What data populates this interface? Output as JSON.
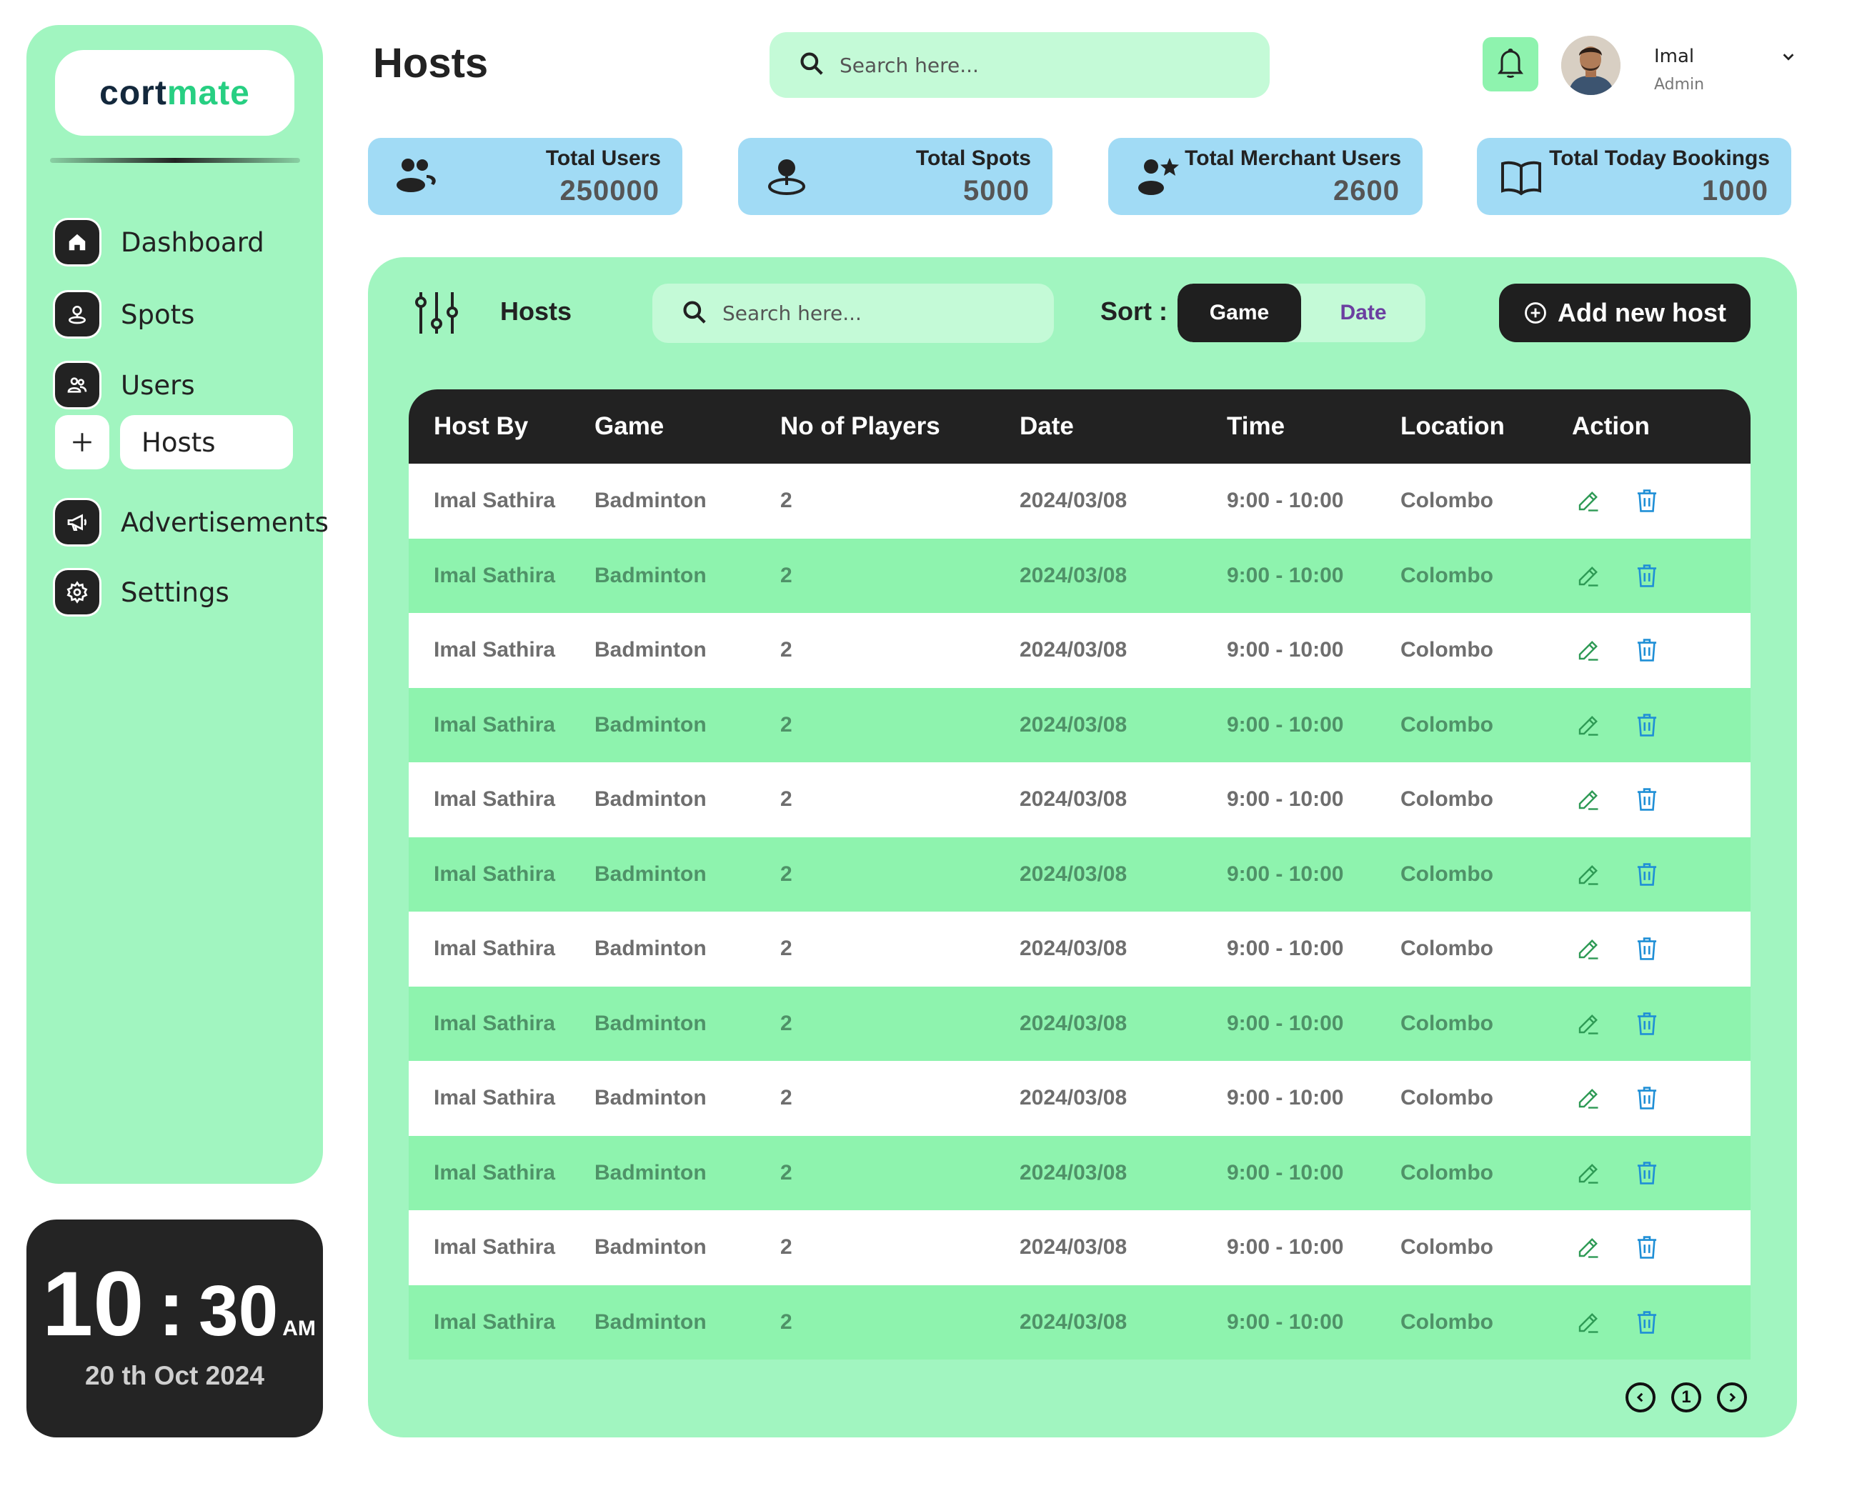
{
  "brand": {
    "logo_part1": "cort",
    "logo_part2": "mate"
  },
  "sidebar": {
    "items": [
      {
        "label": "Dashboard",
        "icon": "home-icon"
      },
      {
        "label": "Spots",
        "icon": "location-pin-icon"
      },
      {
        "label": "Users",
        "icon": "users-icon"
      },
      {
        "label": "Hosts",
        "icon": "plus-icon",
        "active": true
      },
      {
        "label": "Advertisements",
        "icon": "megaphone-icon"
      },
      {
        "label": "Settings",
        "icon": "gear-icon"
      }
    ]
  },
  "clock": {
    "hour": "10",
    "separator": ":",
    "minute": "30",
    "ampm": "AM",
    "date": "20 th Oct 2024"
  },
  "header": {
    "title": "Hosts",
    "search_placeholder": "Search here...",
    "user": {
      "name": "Imal",
      "role": "Admin"
    }
  },
  "stats": [
    {
      "label": "Total Users",
      "value": "250000",
      "icon": "users-icon"
    },
    {
      "label": "Total Spots",
      "value": "5000",
      "icon": "location-pin-icon"
    },
    {
      "label": "Total Merchant Users",
      "value": "2600",
      "icon": "merchant-star-icon"
    },
    {
      "label": "Total Today Bookings",
      "value": "1000",
      "icon": "open-book-icon"
    }
  ],
  "panel": {
    "title": "Hosts",
    "search_placeholder": "Search here...",
    "sort_label": "Sort :",
    "sort_options": [
      "Game",
      "Date"
    ],
    "sort_selected": "Game",
    "add_button": "Add new host"
  },
  "table": {
    "columns": [
      "Host By",
      "Game",
      "No of Players",
      "Date",
      "Time",
      "Location",
      "Action"
    ],
    "rows": [
      [
        "Imal Sathira",
        "Badminton",
        "2",
        "2024/03/08",
        "9:00 - 10:00",
        "Colombo"
      ],
      [
        "Imal Sathira",
        "Badminton",
        "2",
        "2024/03/08",
        "9:00 - 10:00",
        "Colombo"
      ],
      [
        "Imal Sathira",
        "Badminton",
        "2",
        "2024/03/08",
        "9:00 - 10:00",
        "Colombo"
      ],
      [
        "Imal Sathira",
        "Badminton",
        "2",
        "2024/03/08",
        "9:00 - 10:00",
        "Colombo"
      ],
      [
        "Imal Sathira",
        "Badminton",
        "2",
        "2024/03/08",
        "9:00 - 10:00",
        "Colombo"
      ],
      [
        "Imal Sathira",
        "Badminton",
        "2",
        "2024/03/08",
        "9:00 - 10:00",
        "Colombo"
      ],
      [
        "Imal Sathira",
        "Badminton",
        "2",
        "2024/03/08",
        "9:00 - 10:00",
        "Colombo"
      ],
      [
        "Imal Sathira",
        "Badminton",
        "2",
        "2024/03/08",
        "9:00 - 10:00",
        "Colombo"
      ],
      [
        "Imal Sathira",
        "Badminton",
        "2",
        "2024/03/08",
        "9:00 - 10:00",
        "Colombo"
      ],
      [
        "Imal Sathira",
        "Badminton",
        "2",
        "2024/03/08",
        "9:00 - 10:00",
        "Colombo"
      ],
      [
        "Imal Sathira",
        "Badminton",
        "2",
        "2024/03/08",
        "9:00 - 10:00",
        "Colombo"
      ],
      [
        "Imal Sathira",
        "Badminton",
        "2",
        "2024/03/08",
        "9:00 - 10:00",
        "Colombo"
      ]
    ]
  },
  "pagination": {
    "current": "1"
  },
  "colors": {
    "sidebar_bg": "#a1f5c0",
    "search_bg": "#c4fad7",
    "stat_card_bg": "#a1dbf5",
    "row_alt": "#8ef3ae",
    "dark": "#222222",
    "brand_green": "#27cf82",
    "edit_icon": "#2e9a55",
    "delete_icon": "#1f8fd6",
    "sort_date_text": "#6b3fa0"
  }
}
